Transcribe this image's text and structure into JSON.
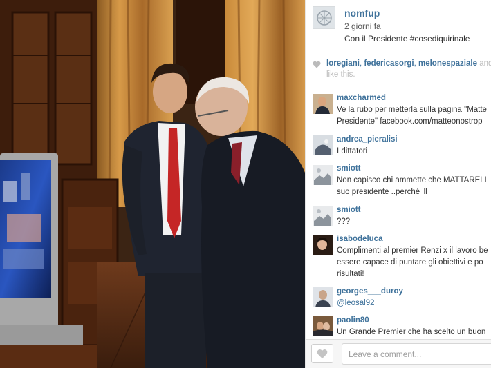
{
  "post": {
    "owner": "nomfup",
    "time": "2 giorni fa",
    "caption": "Con il Presidente #cosediquirinale",
    "photo_icon": "photo-of-two-men-watching-tv"
  },
  "likes": {
    "users": [
      "loregiani",
      "federicasorgi",
      "melonespaziale"
    ],
    "separator": ",",
    "more": "and",
    "suffix": "like this.",
    "icon": "heart-icon"
  },
  "comments": [
    {
      "user": "maxcharmed",
      "lines": [
        "Ve la rubo per metterla sulla pagina \"Matte",
        "Presidente\" facebook.com/matteonostrop"
      ]
    },
    {
      "user": "andrea_pieralisi",
      "lines": [
        "I dittatori"
      ]
    },
    {
      "user": "smiott",
      "lines": [
        "Non capisco chi ammette che MATTARELL",
        "suo presidente ..perché 'll"
      ]
    },
    {
      "user": "smiott",
      "lines": [
        "???"
      ]
    },
    {
      "user": "isabodeluca",
      "lines": [
        "Complimenti al premier Renzi x il lavoro be",
        "essere capace di puntare gli obiettivi e po",
        "risultati!"
      ]
    },
    {
      "user": "georges___duroy",
      "lines": [
        "@leosal92"
      ]
    },
    {
      "user": "paolin80",
      "lines": [
        "Un Grande Premier che ha scelto un buon"
      ]
    }
  ],
  "comment_bar": {
    "placeholder": "Leave a comment...",
    "value": "",
    "like_icon": "heart-icon"
  },
  "colors": {
    "username": "#3f729b",
    "text": "#333333",
    "muted": "#bbbbbb"
  }
}
